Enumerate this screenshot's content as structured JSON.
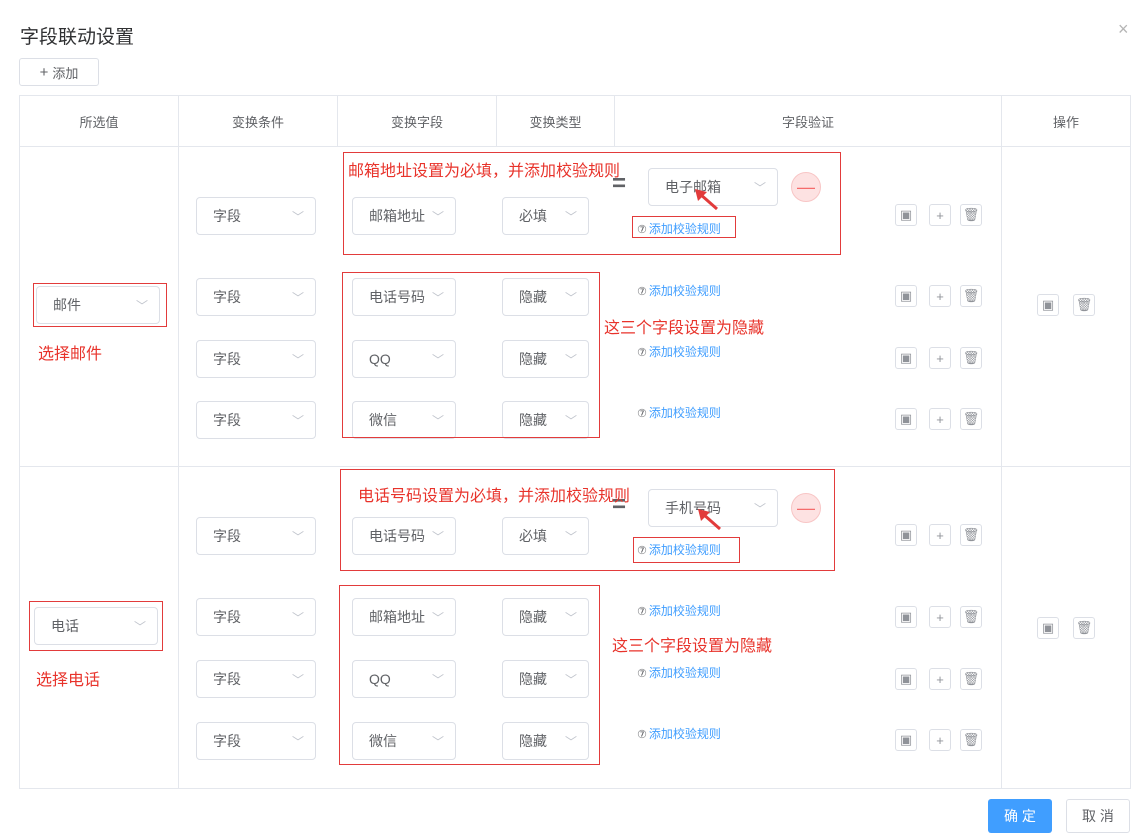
{
  "dialog": {
    "title": "字段联动设置",
    "close": "×",
    "add_button": "添加",
    "confirm": "确 定",
    "cancel": "取 消"
  },
  "table": {
    "headers": [
      "所选值",
      "变换条件",
      "变换字段",
      "变换类型",
      "字段验证",
      "操作"
    ]
  },
  "groups": [
    {
      "value": "邮件",
      "note": "选择邮件",
      "rows": [
        {
          "cond": "字段",
          "field": "邮箱地址",
          "type": "必填",
          "validation_select": "电子邮箱",
          "link": "添加校验规则"
        },
        {
          "cond": "字段",
          "field": "电话号码",
          "type": "隐藏",
          "link": "添加校验规则"
        },
        {
          "cond": "字段",
          "field": "QQ",
          "type": "隐藏",
          "link": "添加校验规则"
        },
        {
          "cond": "字段",
          "field": "微信",
          "type": "隐藏",
          "link": "添加校验规则"
        }
      ],
      "ann_required": "邮箱地址设置为必填，并添加校验规则",
      "ann_hidden": "这三个字段设置为隐藏"
    },
    {
      "value": "电话",
      "note": "选择电话",
      "rows": [
        {
          "cond": "字段",
          "field": "电话号码",
          "type": "必填",
          "validation_select": "手机号码",
          "link": "添加校验规则"
        },
        {
          "cond": "字段",
          "field": "邮箱地址",
          "type": "隐藏",
          "link": "添加校验规则"
        },
        {
          "cond": "字段",
          "field": "QQ",
          "type": "隐藏",
          "link": "添加校验规则"
        },
        {
          "cond": "字段",
          "field": "微信",
          "type": "隐藏",
          "link": "添加校验规则"
        }
      ],
      "ann_required": "电话号码设置为必填，并添加校验规则",
      "ann_hidden": "这三个字段设置为隐藏"
    }
  ],
  "icons": {
    "plus": "+",
    "chevron": "﹀",
    "question": "⑦",
    "minus": "—",
    "copy": "▣",
    "trash": "🗑",
    "equals": "="
  },
  "colors": {
    "primary": "#409eff",
    "annotation": "#e8332b",
    "danger": "#f56c6c"
  }
}
